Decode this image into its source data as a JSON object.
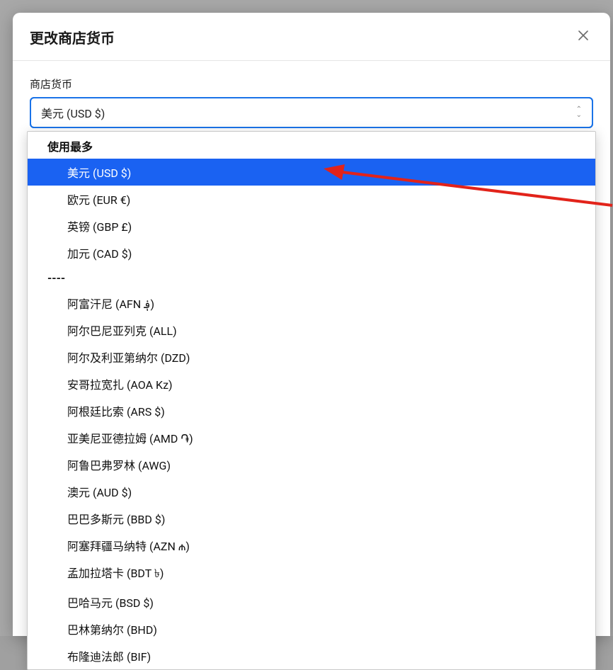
{
  "modal": {
    "title": "更改商店货币",
    "close_label": "✕"
  },
  "field": {
    "label": "商店货币",
    "selected_value": "美元 (USD $)"
  },
  "dropdown": {
    "group_header": "使用最多",
    "most_used": [
      "美元 (USD $)",
      "欧元 (EUR €)",
      "英镑 (GBP £)",
      "加元 (CAD $)"
    ],
    "divider": "----",
    "all": [
      "阿富汗尼 (AFN ؋)",
      "阿尔巴尼亚列克 (ALL)",
      "阿尔及利亚第纳尔 (DZD)",
      "安哥拉宽扎 (AOA Kz)",
      "阿根廷比索 (ARS $)",
      "亚美尼亚德拉姆 (AMD ֏)",
      "阿鲁巴弗罗林 (AWG)",
      "澳元 (AUD $)",
      "巴巴多斯元 (BBD $)",
      "阿塞拜疆马纳特 (AZN ₼)",
      "孟加拉塔卡 (BDT ৳)",
      "巴哈马元 (BSD $)",
      "巴林第纳尔 (BHD)",
      "布隆迪法郎 (BIF)"
    ],
    "selected_index": 0
  }
}
